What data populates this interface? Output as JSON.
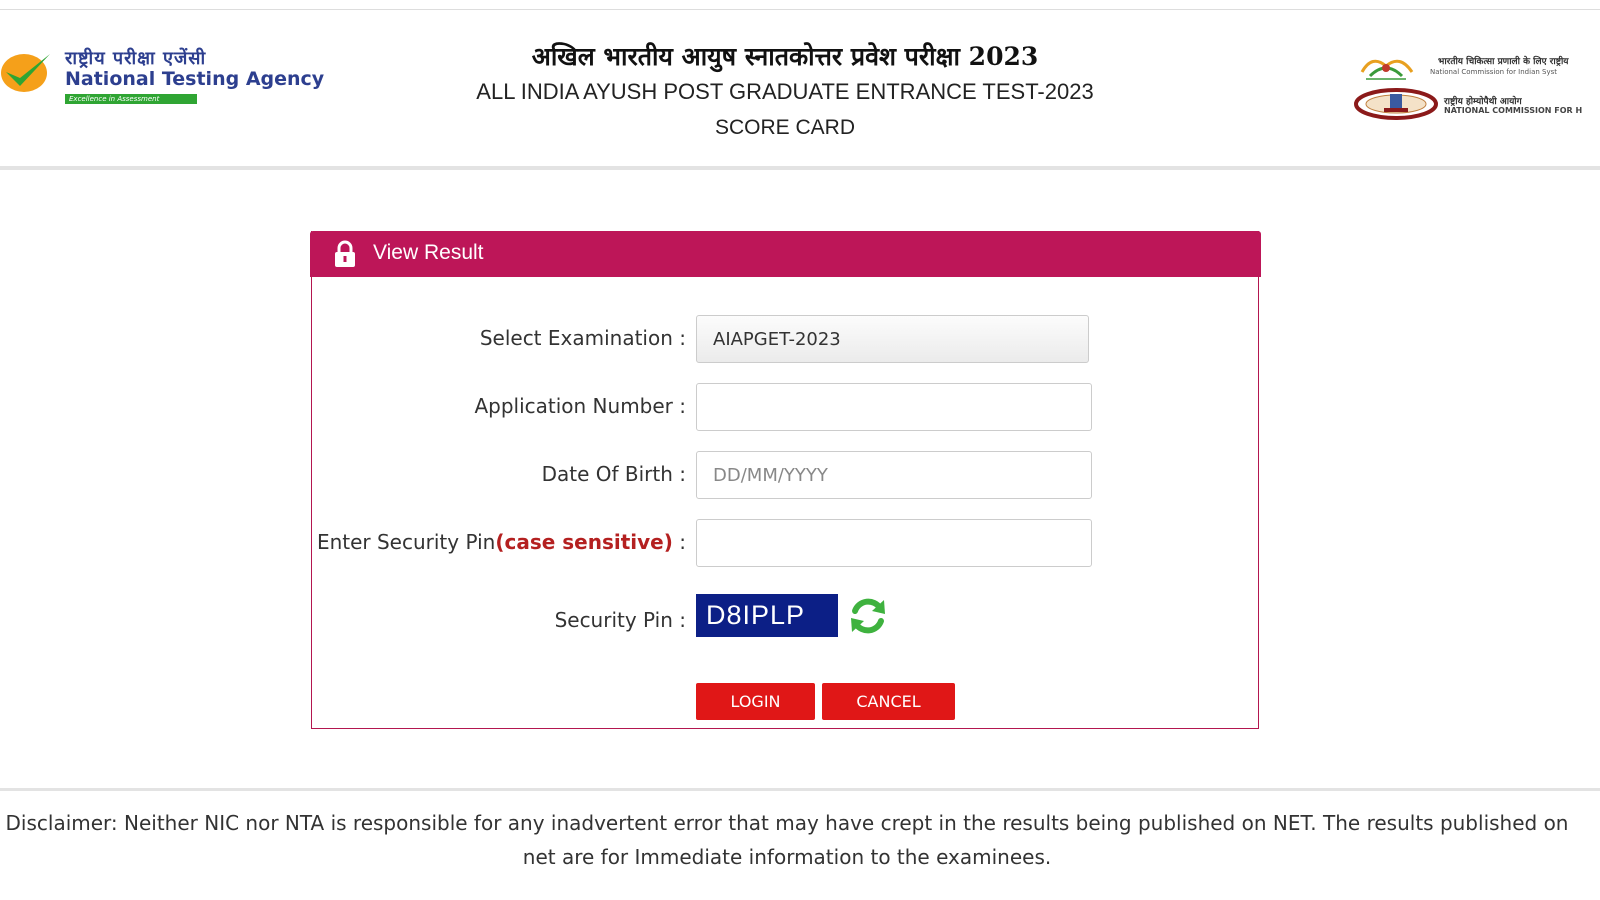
{
  "header": {
    "nta_logo": {
      "hindi": "राष्ट्रीय परीक्षा एजेंसी",
      "english": "National Testing Agency",
      "tagline": "Excellence in Assessment",
      "icon": "nta-checkmark-logo"
    },
    "title_hindi": "अखिल भारतीय आयुष स्नातकोत्तर प्रवेश परीक्षा 2023",
    "title_english": "ALL INDIA AYUSH POST GRADUATE ENTRANCE TEST-2023",
    "subtitle": "SCORE CARD",
    "right_logos": {
      "ncism_hindi": "भारतीय चिकित्सा प्रणाली के लिए राष्ट्रीय",
      "ncism_english": "National Commission for Indian Syst",
      "nch_hindi": "राष्ट्रीय होम्योपैथी आयोग",
      "nch_english": "NATIONAL COMMISSION FOR H"
    }
  },
  "panel": {
    "title": "View Result",
    "icon": "lock-icon",
    "fields": {
      "exam_label": "Select Examination :",
      "exam_value": "AIAPGET-2023",
      "app_label": "Application Number :",
      "app_value": "",
      "dob_label": "Date Of Birth :",
      "dob_placeholder": "DD/MM/YYYY",
      "pin_label_prefix": "Enter Security Pin",
      "pin_label_highlight": "(case sensitive)",
      "pin_label_suffix": " :",
      "pin_value": "",
      "captcha_label": "Security Pin :",
      "captcha_value": "D8IPLP"
    },
    "buttons": {
      "login": "LOGIN",
      "cancel": "CANCEL"
    }
  },
  "footer": {
    "disclaimer": "Disclaimer: Neither NIC nor NTA is responsible for any inadvertent error that may have crept in the results being published on NET. The results published on net are for Immediate information to the examinees."
  },
  "colors": {
    "panel_header": "#bd1658",
    "button": "#e01717",
    "captcha_bg": "#0c1f86",
    "highlight_red": "#b42020",
    "nta_blue": "#2d3f8f",
    "nta_green": "#2fa533"
  }
}
